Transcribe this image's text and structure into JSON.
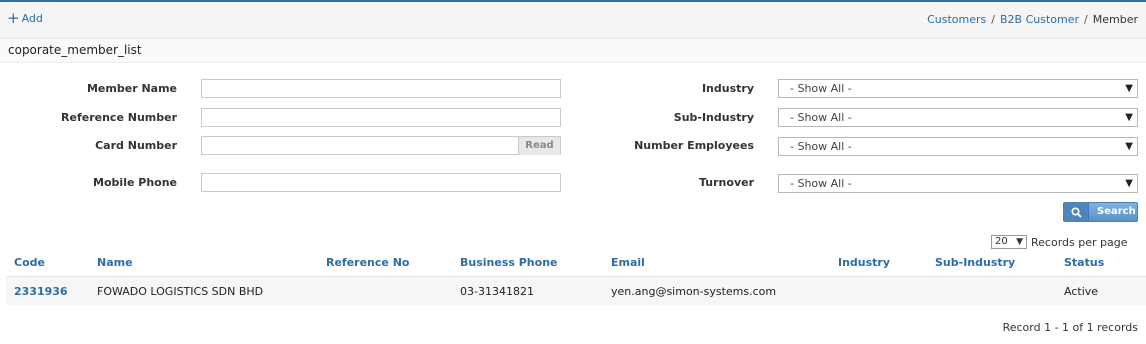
{
  "toolbar": {
    "add_label": "Add",
    "breadcrumb": [
      "Customers",
      "B2B Customer",
      "Member"
    ]
  },
  "page": {
    "title": "coporate_member_list"
  },
  "filters": {
    "member_name": {
      "label": "Member Name",
      "value": ""
    },
    "reference_number": {
      "label": "Reference Number",
      "value": ""
    },
    "card_number": {
      "label": "Card Number",
      "value": "",
      "read_button": "Read"
    },
    "mobile_phone": {
      "label": "Mobile Phone",
      "value": ""
    },
    "industry": {
      "label": "Industry",
      "selected": "- Show All -"
    },
    "sub_industry": {
      "label": "Sub-Industry",
      "selected": "- Show All -"
    },
    "number_employees": {
      "label": "Number Employees",
      "selected": "- Show All -"
    },
    "turnover": {
      "label": "Turnover",
      "selected": "- Show All -"
    },
    "search_label": "Search"
  },
  "pagination": {
    "per_page": "20",
    "per_page_label": "Records per page",
    "record_info": "Record 1 - 1 of 1 records"
  },
  "table": {
    "columns": [
      "Code",
      "Name",
      "Reference No",
      "Business Phone",
      "Email",
      "Industry",
      "Sub-Industry",
      "Status"
    ],
    "rows": [
      {
        "code": "2331936",
        "name": "FOWADO LOGISTICS SDN BHD",
        "reference_no": "",
        "business_phone": "03-31341821",
        "email": "yen.ang@simon-systems.com",
        "industry": "",
        "sub_industry": "",
        "status": "Active"
      }
    ]
  },
  "colors": {
    "accent": "#2e6da4",
    "search_button": "#5a91c6"
  }
}
